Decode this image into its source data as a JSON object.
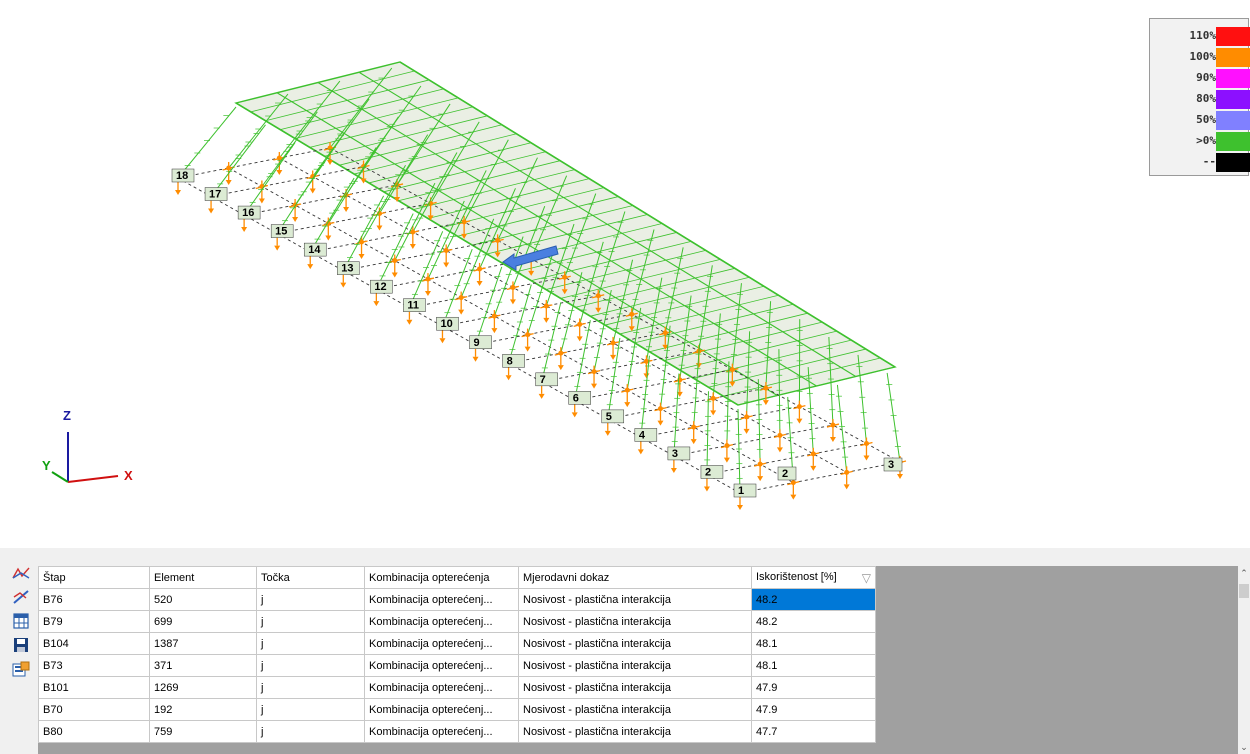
{
  "legend": {
    "items": [
      {
        "label": "110%",
        "color": "#ff1010"
      },
      {
        "label": "100%",
        "color": "#ff8c00"
      },
      {
        "label": "90%",
        "color": "#ff10ff"
      },
      {
        "label": "80%",
        "color": "#8c10ff"
      },
      {
        "label": "50%",
        "color": "#8080ff"
      },
      {
        "label": ">0%",
        "color": "#3ec12e"
      },
      {
        "label": "--",
        "color": "#000000"
      }
    ]
  },
  "axes": {
    "z": "Z",
    "y": "Y",
    "x": "X"
  },
  "node_labels_left": [
    "18",
    "17",
    "16",
    "15",
    "14",
    "13",
    "12",
    "11",
    "10",
    "9",
    "8",
    "7",
    "6",
    "5",
    "4",
    "3",
    "2",
    "1"
  ],
  "node_labels_right": [
    "2",
    "3"
  ],
  "toolbar": {
    "icons": [
      "diagram-icon",
      "member-diagram-icon",
      "table-icon",
      "save-icon",
      "export-icon"
    ]
  },
  "table": {
    "columns": [
      "Štap",
      "Element",
      "Točka",
      "Kombinacija opterećenja",
      "Mjerodavni dokaz",
      "Iskorištenost [%]"
    ],
    "rows": [
      [
        "B76",
        "520",
        "j",
        "Kombinacija opterećenj...",
        "Nosivost - plastična interakcija",
        "48.2"
      ],
      [
        "B79",
        "699",
        "j",
        "Kombinacija opterećenj...",
        "Nosivost - plastična interakcija",
        "48.2"
      ],
      [
        "B104",
        "1387",
        "j",
        "Kombinacija opterećenj...",
        "Nosivost - plastična interakcija",
        "48.1"
      ],
      [
        "B73",
        "371",
        "j",
        "Kombinacija opterećenj...",
        "Nosivost - plastična interakcija",
        "48.1"
      ],
      [
        "B101",
        "1269",
        "j",
        "Kombinacija opterećenj...",
        "Nosivost - plastična interakcija",
        "47.9"
      ],
      [
        "B70",
        "192",
        "j",
        "Kombinacija opterećenj...",
        "Nosivost - plastična interakcija",
        "47.9"
      ],
      [
        "B80",
        "759",
        "j",
        "Kombinacija opterećenj...",
        "Nosivost - plastična interakcija",
        "47.7"
      ]
    ],
    "sort_icon": "▽"
  },
  "colors": {
    "structure": "#3ec12e",
    "support": "#ff8c00",
    "arrow": "#4a7fe0",
    "selection": "#0078d7"
  }
}
